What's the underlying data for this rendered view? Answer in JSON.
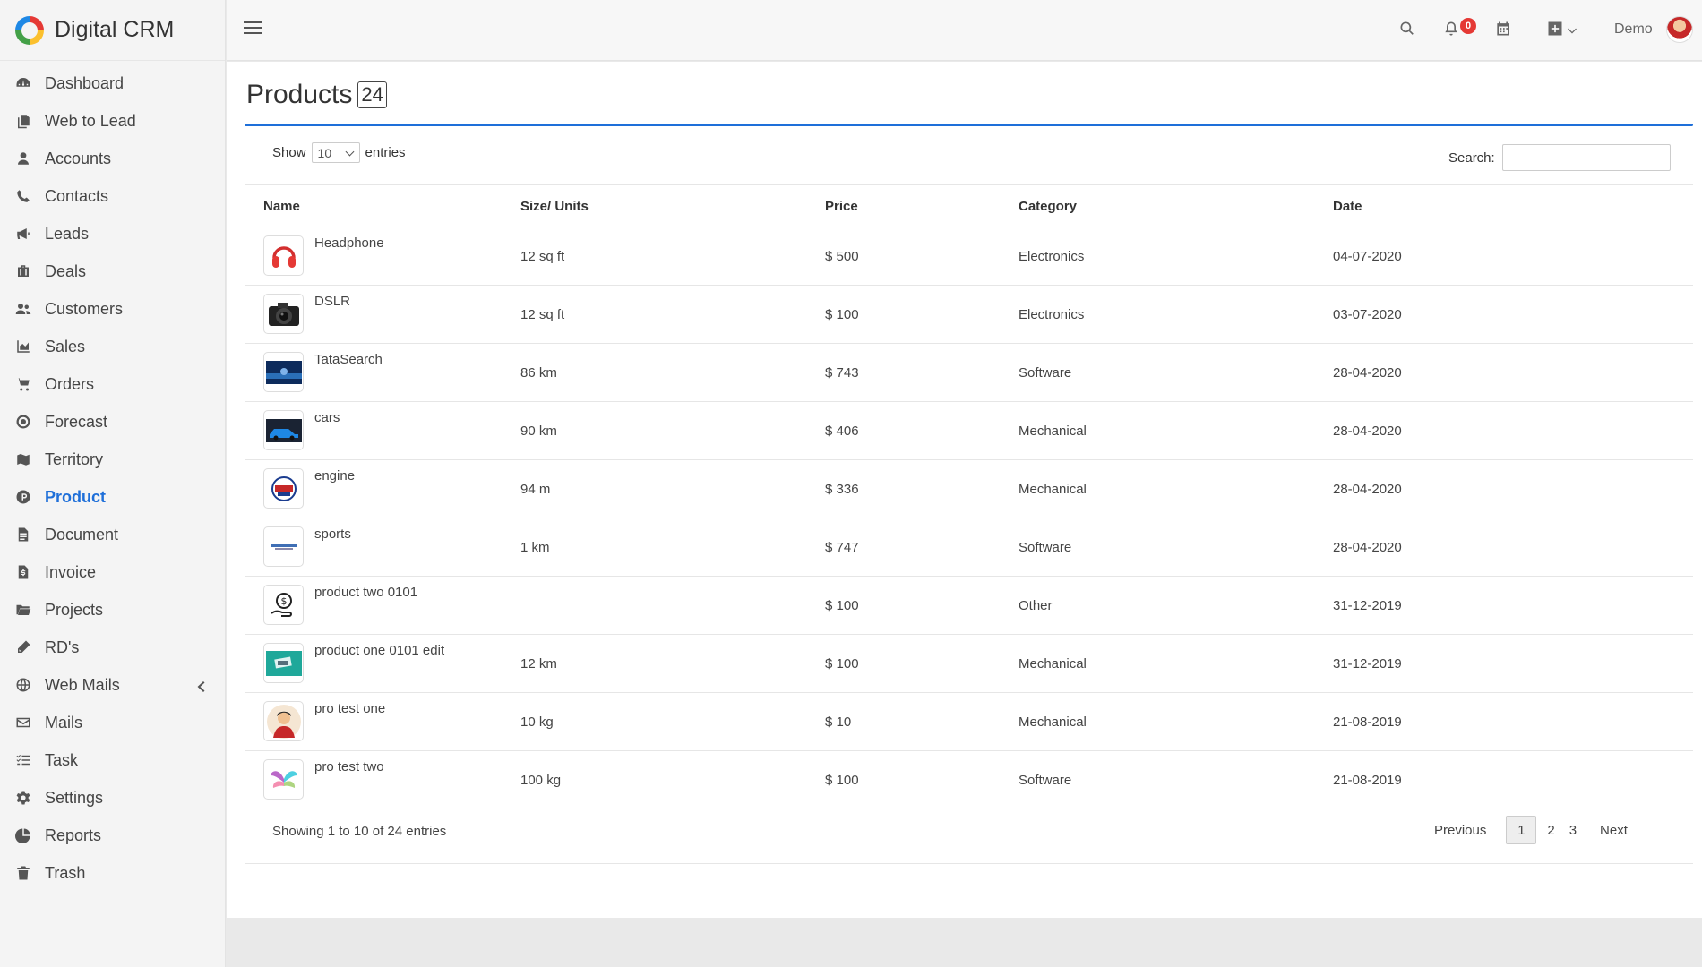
{
  "app": {
    "name": "Digital CRM"
  },
  "sidebar": {
    "items": [
      {
        "label": "Dashboard",
        "icon": "dashboard-icon"
      },
      {
        "label": "Web to Lead",
        "icon": "copy-icon"
      },
      {
        "label": "Accounts",
        "icon": "user-icon"
      },
      {
        "label": "Contacts",
        "icon": "phone-icon"
      },
      {
        "label": "Leads",
        "icon": "megaphone-icon"
      },
      {
        "label": "Deals",
        "icon": "briefcase-icon"
      },
      {
        "label": "Customers",
        "icon": "users-icon"
      },
      {
        "label": "Sales",
        "icon": "area-chart-icon"
      },
      {
        "label": "Orders",
        "icon": "cart-icon"
      },
      {
        "label": "Forecast",
        "icon": "target-icon"
      },
      {
        "label": "Territory",
        "icon": "map-icon"
      },
      {
        "label": "Product",
        "icon": "product-icon"
      },
      {
        "label": "Document",
        "icon": "file-icon"
      },
      {
        "label": "Invoice",
        "icon": "invoice-icon"
      },
      {
        "label": "Projects",
        "icon": "folder-icon"
      },
      {
        "label": "RD's",
        "icon": "pencil-icon"
      },
      {
        "label": "Web Mails",
        "icon": "globe-icon"
      },
      {
        "label": "Mails",
        "icon": "envelope-icon"
      },
      {
        "label": "Task",
        "icon": "tasks-icon"
      },
      {
        "label": "Settings",
        "icon": "gear-icon"
      },
      {
        "label": "Reports",
        "icon": "pie-chart-icon"
      },
      {
        "label": "Trash",
        "icon": "trash-icon"
      }
    ],
    "active": "Product"
  },
  "topbar": {
    "notification_count": "0",
    "user_name": "Demo"
  },
  "page": {
    "title": "Products",
    "count": "24"
  },
  "table_controls": {
    "show_label": "Show",
    "page_length": "10",
    "entries_label": "entries",
    "search_label": "Search:",
    "search_value": ""
  },
  "table": {
    "columns": [
      "Name",
      "Size/ Units",
      "Price",
      "Category",
      "Date"
    ],
    "rows": [
      {
        "name": "Headphone",
        "size": "12 sq ft",
        "price": "$ 500",
        "category": "Electronics",
        "date": "04-07-2020",
        "thumb": "headphone"
      },
      {
        "name": "DSLR",
        "size": "12 sq ft",
        "price": "$ 100",
        "category": "Electronics",
        "date": "03-07-2020",
        "thumb": "camera"
      },
      {
        "name": "TataSearch",
        "size": "86 km",
        "price": "$ 743",
        "category": "Software",
        "date": "28-04-2020",
        "thumb": "banner-blue"
      },
      {
        "name": "cars",
        "size": "90 km",
        "price": "$ 406",
        "category": "Mechanical",
        "date": "28-04-2020",
        "thumb": "car"
      },
      {
        "name": "engine",
        "size": "94 m",
        "price": "$ 336",
        "category": "Mechanical",
        "date": "28-04-2020",
        "thumb": "badge"
      },
      {
        "name": "sports",
        "size": "1 km",
        "price": "$ 747",
        "category": "Software",
        "date": "28-04-2020",
        "thumb": "logo-small"
      },
      {
        "name": "product two 0101",
        "size": "",
        "price": "$ 100",
        "category": "Other",
        "date": "31-12-2019",
        "thumb": "money-hand"
      },
      {
        "name": "product one 0101 edit",
        "size": "12 km",
        "price": "$ 100",
        "category": "Mechanical",
        "date": "31-12-2019",
        "thumb": "teal-card"
      },
      {
        "name": "pro test one",
        "size": "10 kg",
        "price": "$ 10",
        "category": "Mechanical",
        "date": "21-08-2019",
        "thumb": "person"
      },
      {
        "name": "pro test two",
        "size": "100 kg",
        "price": "$ 100",
        "category": "Software",
        "date": "21-08-2019",
        "thumb": "wings"
      }
    ]
  },
  "footer": {
    "info": "Showing 1 to 10 of 24 entries",
    "previous": "Previous",
    "pages": [
      "1",
      "2",
      "3"
    ],
    "current_page": "1",
    "next": "Next"
  },
  "colors": {
    "accent": "#1e6fd9",
    "badge": "#e53935"
  }
}
